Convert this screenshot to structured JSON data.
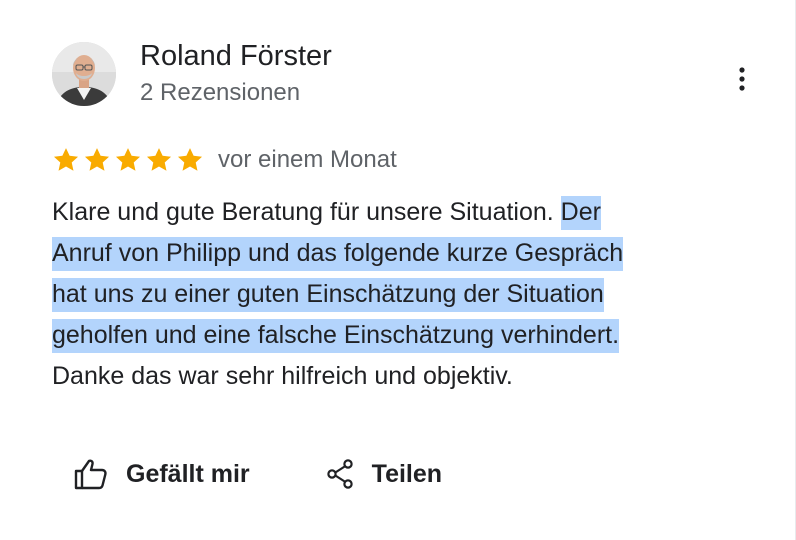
{
  "author": {
    "name": "Roland Förster",
    "meta": "2 Rezensionen",
    "avatar_icon": "person-photo-avatar"
  },
  "menu": {
    "icon": "more-vertical-icon"
  },
  "review": {
    "rating": 5,
    "rating_max": 5,
    "star_color": "#f9ab00",
    "date": "vor einem Monat",
    "lines": [
      {
        "plain": "Klare und gute Beratung für unsere Situation. ",
        "selected": "Der"
      },
      {
        "plain": "",
        "selected": "Anruf von Philipp und das folgende kurze Gespräch"
      },
      {
        "plain": "",
        "selected": "hat uns zu einer guten Einschätzung der Situation"
      },
      {
        "plain": "",
        "selected": "geholfen und eine falsche Einschätzung verhindert."
      },
      {
        "plain": "Danke das war sehr hilfreich und objektiv.",
        "selected": ""
      }
    ],
    "selection_color": "#b3d4fc"
  },
  "actions": {
    "like": {
      "label": "Gefällt mir",
      "icon": "thumbs-up-icon"
    },
    "share": {
      "label": "Teilen",
      "icon": "share-icon"
    }
  }
}
